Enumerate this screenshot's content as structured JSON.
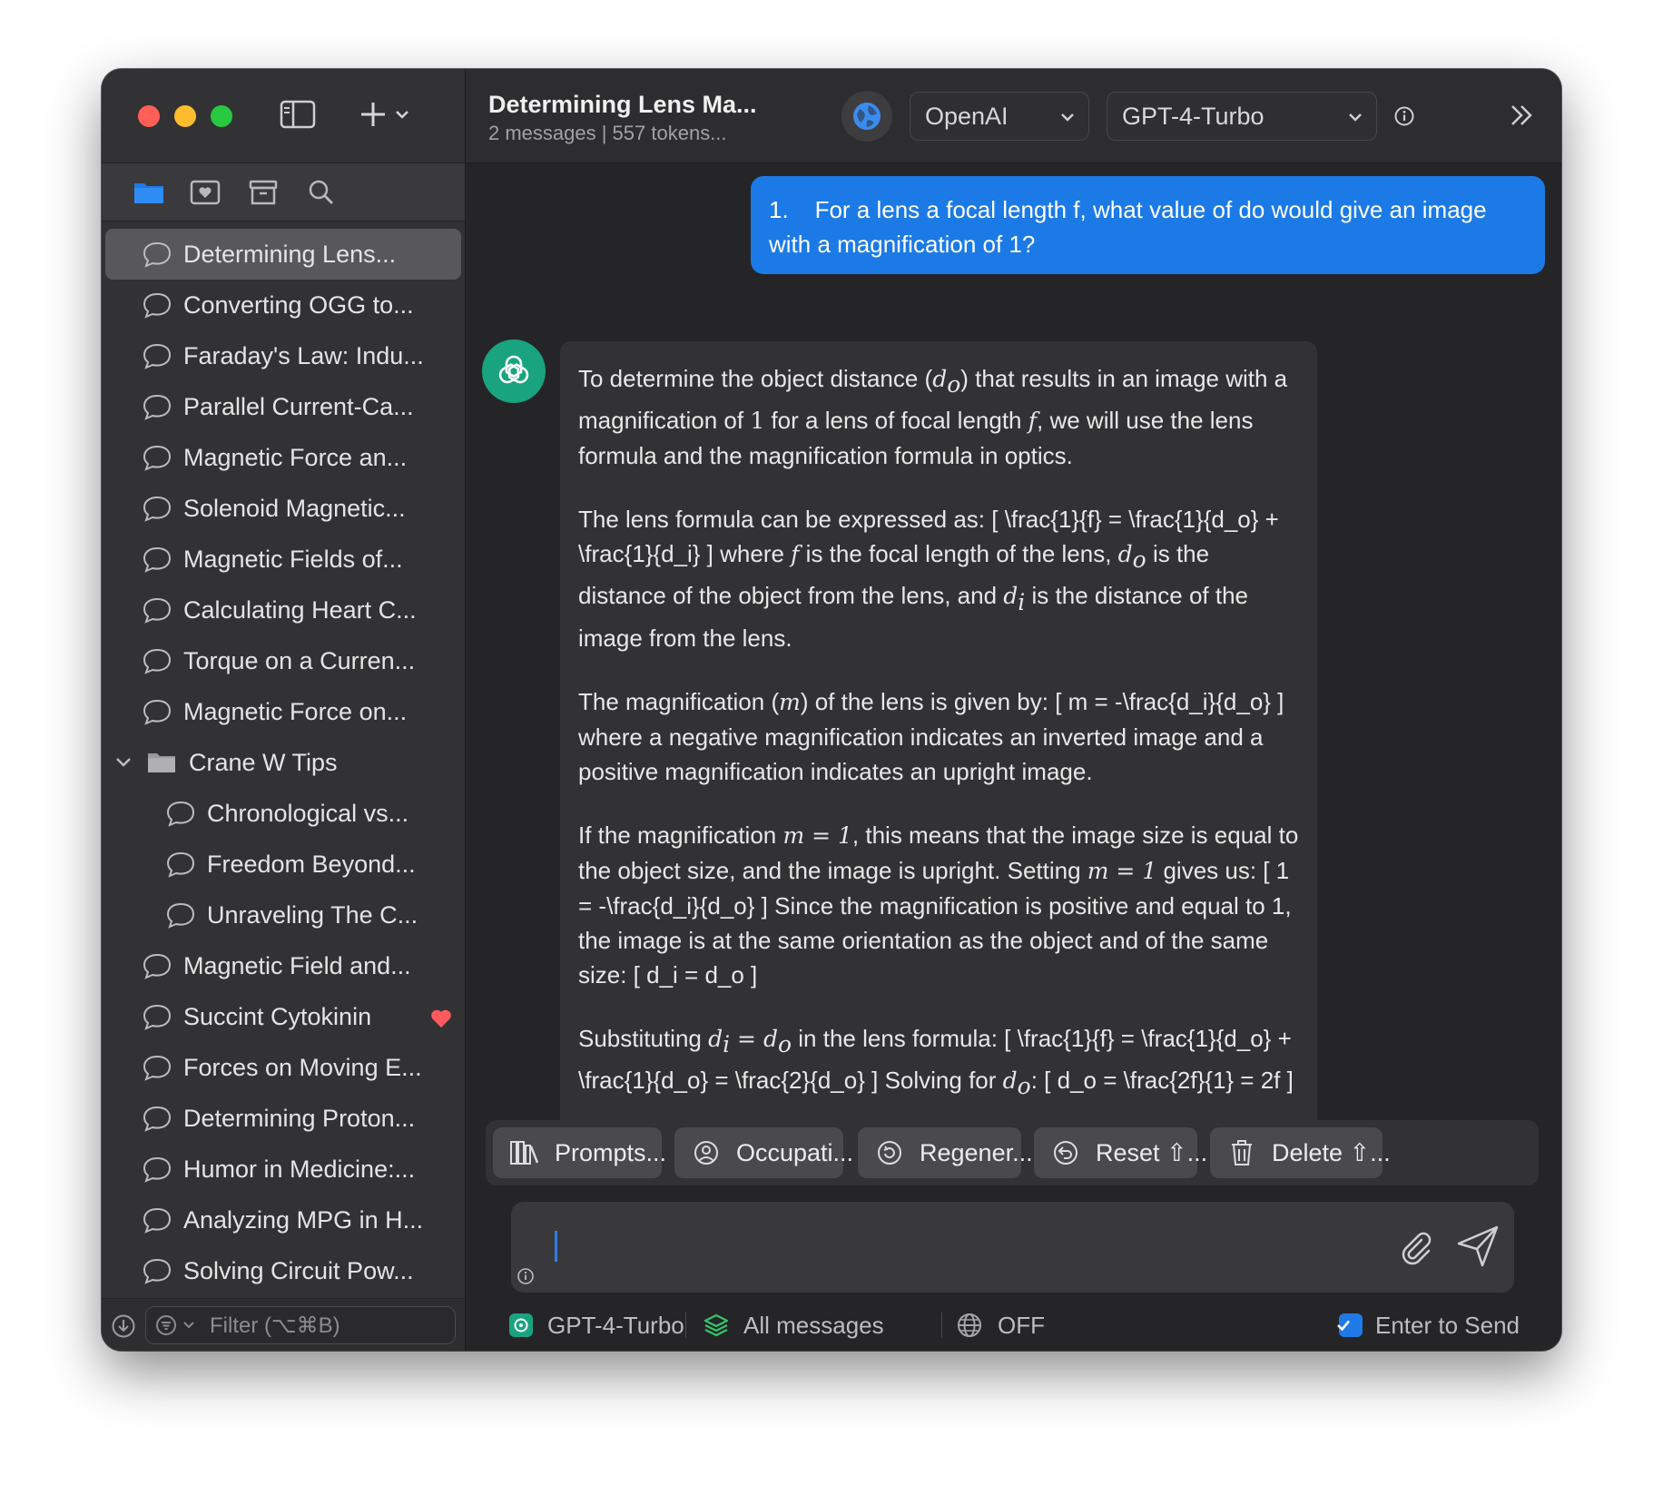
{
  "sidebar": {
    "items": [
      {
        "label": "Determining Lens..."
      },
      {
        "label": "Converting OGG to..."
      },
      {
        "label": "Faraday's Law: Indu..."
      },
      {
        "label": "Parallel Current-Ca..."
      },
      {
        "label": "Magnetic Force an..."
      },
      {
        "label": "Solenoid Magnetic..."
      },
      {
        "label": "Magnetic Fields of..."
      },
      {
        "label": "Calculating Heart C..."
      },
      {
        "label": "Torque on a Curren..."
      },
      {
        "label": "Magnetic Force on..."
      }
    ],
    "folder": {
      "label": "Crane W Tips",
      "children": [
        {
          "label": "Chronological vs..."
        },
        {
          "label": "Freedom Beyond..."
        },
        {
          "label": "Unraveling The C..."
        }
      ]
    },
    "items_after": [
      {
        "label": "Magnetic Field and..."
      },
      {
        "label": "Succint Cytokinin"
      },
      {
        "label": "Forces on Moving E..."
      },
      {
        "label": "Determining Proton..."
      },
      {
        "label": "Humor in Medicine:..."
      },
      {
        "label": "Analyzing MPG in H..."
      },
      {
        "label": "Solving Circuit Pow..."
      }
    ],
    "filter_placeholder": "Filter (⌥⌘B)"
  },
  "header": {
    "title": "Determining Lens Ma...",
    "meta": "2 messages  |  557 tokens...",
    "provider": "OpenAI",
    "model": "GPT-4-Turbo"
  },
  "messages": {
    "user": "1.    For a lens a focal length f, what value of do would give an image with a magnification of 1?",
    "assistant": {
      "p1_a": "To determine the object distance (",
      "p1_sym1": "d",
      "p1_sub1": "o",
      "p1_b": ") that results in an image with a magnification of ",
      "p1_one": "1",
      "p1_c": " for a lens of focal length ",
      "p1_f": "f",
      "p1_d": ", we will use the lens formula and the magnification formula in optics.",
      "p2_a": "The lens formula can be expressed as: [ \\frac{1}{f} = \\frac{1}{d_o} + \\frac{1}{d_i} ] where ",
      "p2_f": "f",
      "p2_b": " is the focal length of the lens, ",
      "p2_d1": "d",
      "p2_s1": "o",
      "p2_c": " is the distance of the object from the lens, and ",
      "p2_d2": "d",
      "p2_s2": "i",
      "p2_d": " is the distance of the image from the lens.",
      "p3_a": "The magnification (",
      "p3_m": "m",
      "p3_b": ") of the lens is given by: [ m = -\\frac{d_i}{d_o} ] where a negative magnification indicates an inverted image and a positive magnification indicates an upright image.",
      "p4_a": "If the magnification ",
      "p4_eq1": "m = 1",
      "p4_b": ", this means that the image size is equal to the object size, and the image is upright. Setting ",
      "p4_eq2": "m = 1",
      "p4_c": " gives us: [ 1 = -\\frac{d_i}{d_o} ] Since the magnification is positive and equal to 1, the image is at the same orientation as the object and of the same size: [ d_i = d_o ]",
      "p5_a": "Substituting ",
      "p5_di": "d",
      "p5_si": "i",
      "p5_eq": " = ",
      "p5_do": "d",
      "p5_so": "o",
      "p5_b": " in the lens formula: [ \\frac{1}{f} = \\frac{1}{d_o} + \\frac{1}{d_o} = \\frac{2}{d_o} ] Solving for ",
      "p5_d3": "d",
      "p5_s3": "o",
      "p5_c": ": [ d_o = \\frac{2f}{1} = 2f ]"
    }
  },
  "actions": {
    "prompts": "Prompts...",
    "occupation": "Occupati...",
    "regenerate": "Regener...",
    "reset": "Reset ⇧...",
    "delete": "Delete ⇧..."
  },
  "status": {
    "model": "GPT-4-Turbo",
    "context": "All messages",
    "web": "OFF",
    "enter_to_send": "Enter to Send"
  },
  "colors": {
    "accent": "#1c7ae6",
    "ai_avatar": "#19a37f",
    "heart": "#ff5a5f"
  }
}
